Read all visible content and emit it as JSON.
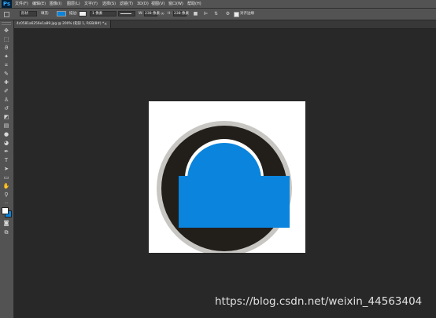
{
  "app": {
    "logo": "Ps",
    "menu": [
      "文件(F)",
      "编辑(E)",
      "图像(I)",
      "图层(L)",
      "文字(Y)",
      "选择(S)",
      "滤镜(T)",
      "3D(D)",
      "视图(V)",
      "窗口(W)",
      "帮助(H)"
    ]
  },
  "options_bar": {
    "shape_mode": "形状",
    "fill_label": "填充:",
    "stroke_label": "描边:",
    "stroke_width": "1 像素",
    "w_label": "W:",
    "w_value": "238 像素",
    "h_label": "H:",
    "h_value": "238 像素",
    "align_edges_label": "对齐边缘",
    "fill_color": "#0a84dc",
    "stroke_color": "#e8e8e8"
  },
  "document": {
    "tab_title": "4c0581a6256e1a89.jpg @ 200% (矩形 1, RGB/8#) *",
    "tab_close": "×"
  },
  "tools": [
    {
      "name": "move-tool-icon",
      "glyph": "✥"
    },
    {
      "name": "marquee-tool-icon",
      "glyph": "⬚"
    },
    {
      "name": "lasso-tool-icon",
      "glyph": "ϑ"
    },
    {
      "name": "magic-wand-tool-icon",
      "glyph": "✦"
    },
    {
      "name": "crop-tool-icon",
      "glyph": "⌗"
    },
    {
      "name": "eyedropper-tool-icon",
      "glyph": "✎"
    },
    {
      "name": "healing-brush-tool-icon",
      "glyph": "✚"
    },
    {
      "name": "brush-tool-icon",
      "glyph": "✐"
    },
    {
      "name": "clone-stamp-tool-icon",
      "glyph": "♙"
    },
    {
      "name": "history-brush-tool-icon",
      "glyph": "↺"
    },
    {
      "name": "eraser-tool-icon",
      "glyph": "◩"
    },
    {
      "name": "gradient-tool-icon",
      "glyph": "▤"
    },
    {
      "name": "blur-tool-icon",
      "glyph": "●"
    },
    {
      "name": "dodge-tool-icon",
      "glyph": "◕"
    },
    {
      "name": "pen-tool-icon",
      "glyph": "✒"
    },
    {
      "name": "type-tool-icon",
      "glyph": "T"
    },
    {
      "name": "path-selection-tool-icon",
      "glyph": "➤"
    },
    {
      "name": "rectangle-tool-icon",
      "glyph": "▭"
    },
    {
      "name": "hand-tool-icon",
      "glyph": "✋"
    },
    {
      "name": "zoom-tool-icon",
      "glyph": "⚲"
    },
    {
      "name": "more-tools-icon",
      "glyph": "···"
    }
  ],
  "colors": {
    "foreground": "#ffffff",
    "background": "#0a84dc",
    "circle_outer_ring": "#c8c6c2",
    "circle_fill": "#221e1a",
    "arch_outline": "#ffffff",
    "blue_shape": "#0a84dc"
  },
  "watermark": "https://blog.csdn.net/weixin_44563404"
}
